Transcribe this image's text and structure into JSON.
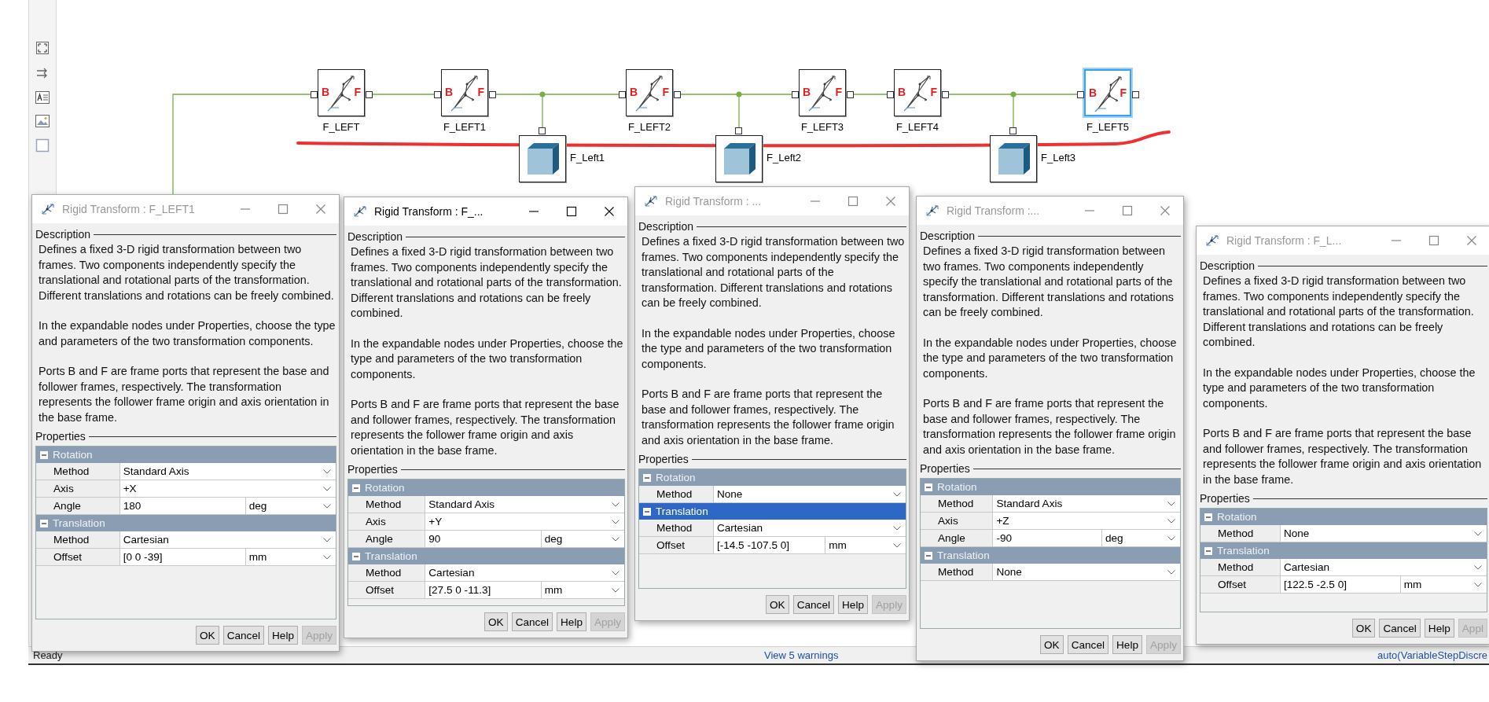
{
  "diagram": {
    "transform_blocks": [
      {
        "name": "F_LEFT",
        "base_port": "B",
        "follower_port": "F",
        "selected": false
      },
      {
        "name": "F_LEFT1",
        "base_port": "B",
        "follower_port": "F",
        "selected": false
      },
      {
        "name": "F_LEFT2",
        "base_port": "B",
        "follower_port": "F",
        "selected": false
      },
      {
        "name": "F_LEFT3",
        "base_port": "B",
        "follower_port": "F",
        "selected": false
      },
      {
        "name": "F_LEFT4",
        "base_port": "B",
        "follower_port": "F",
        "selected": false
      },
      {
        "name": "F_LEFT5",
        "base_port": "B",
        "follower_port": "F",
        "selected": true
      }
    ],
    "solid_blocks": [
      {
        "name": "F_Left1"
      },
      {
        "name": "F_Left2"
      },
      {
        "name": "F_Left3"
      }
    ]
  },
  "dialogs": [
    {
      "title": "Rigid Transform : F_LEFT1",
      "active": false,
      "description_heading": "Description",
      "paragraphs": [
        "Defines a fixed 3-D rigid transformation between two frames. Two components independently specify the translational and rotational parts of the transformation. Different translations and rotations can be freely combined.",
        "In the expandable nodes under Properties, choose the type and parameters of the two transformation components.",
        "Ports B and F are frame ports that represent the base and follower frames, respectively. The transformation represents the follower frame origin and axis orientation in the base frame."
      ],
      "properties_heading": "Properties",
      "sections": [
        {
          "label": "Rotation",
          "expanded": true,
          "selected": false,
          "rows": [
            {
              "label": "Method",
              "value": "Standard Axis"
            },
            {
              "label": "Axis",
              "value": "+X"
            },
            {
              "label": "Angle",
              "value": "180",
              "unit": "deg"
            }
          ]
        },
        {
          "label": "Translation",
          "expanded": true,
          "selected": false,
          "rows": [
            {
              "label": "Method",
              "value": "Cartesian"
            },
            {
              "label": "Offset",
              "value": "[0 0 -39]",
              "unit": "mm"
            }
          ]
        }
      ],
      "buttons": [
        {
          "label": "OK",
          "disabled": false
        },
        {
          "label": "Cancel",
          "disabled": false
        },
        {
          "label": "Help",
          "disabled": false
        },
        {
          "label": "Apply",
          "disabled": true
        }
      ]
    },
    {
      "title": "Rigid Transform : F_...",
      "active": true,
      "description_heading": "Description",
      "paragraphs": [
        "Defines a fixed 3-D rigid transformation between two frames. Two components independently specify the translational and rotational parts of the transformation. Different translations and rotations can be freely combined.",
        "In the expandable nodes under Properties, choose the type and parameters of the two transformation components.",
        "Ports B and F are frame ports that represent the base and follower frames, respectively. The transformation represents the follower frame origin and axis orientation in the base frame."
      ],
      "properties_heading": "Properties",
      "sections": [
        {
          "label": "Rotation",
          "expanded": true,
          "selected": false,
          "rows": [
            {
              "label": "Method",
              "value": "Standard Axis"
            },
            {
              "label": "Axis",
              "value": "+Y"
            },
            {
              "label": "Angle",
              "value": "90",
              "unit": "deg"
            }
          ]
        },
        {
          "label": "Translation",
          "expanded": true,
          "selected": false,
          "rows": [
            {
              "label": "Method",
              "value": "Cartesian"
            },
            {
              "label": "Offset",
              "value": "[27.5 0 -11.3]",
              "unit": "mm"
            }
          ]
        }
      ],
      "buttons": [
        {
          "label": "OK",
          "disabled": false
        },
        {
          "label": "Cancel",
          "disabled": false
        },
        {
          "label": "Help",
          "disabled": false
        },
        {
          "label": "Apply",
          "disabled": true
        }
      ]
    },
    {
      "title": "Rigid Transform : ...",
      "active": false,
      "description_heading": "Description",
      "paragraphs": [
        "Defines a fixed 3-D rigid transformation between two frames. Two components independently specify the translational and rotational parts of the transformation. Different translations and rotations can be freely combined.",
        "In the expandable nodes under Properties, choose the type and parameters of the two transformation components.",
        "Ports B and F are frame ports that represent the base and follower frames, respectively. The transformation represents the follower frame origin and axis orientation in the base frame."
      ],
      "properties_heading": "Properties",
      "sections": [
        {
          "label": "Rotation",
          "expanded": true,
          "selected": false,
          "rows": [
            {
              "label": "Method",
              "value": "None"
            }
          ]
        },
        {
          "label": "Translation",
          "expanded": true,
          "selected": true,
          "rows": [
            {
              "label": "Method",
              "value": "Cartesian"
            },
            {
              "label": "Offset",
              "value": "[-14.5 -107.5 0]",
              "unit": "mm"
            }
          ]
        }
      ],
      "buttons": [
        {
          "label": "OK",
          "disabled": false
        },
        {
          "label": "Cancel",
          "disabled": false
        },
        {
          "label": "Help",
          "disabled": false
        },
        {
          "label": "Apply",
          "disabled": true
        }
      ]
    },
    {
      "title": "Rigid Transform :...",
      "active": false,
      "description_heading": "Description",
      "paragraphs": [
        "Defines a fixed 3-D rigid transformation between two frames. Two components independently specify the translational and rotational parts of the transformation. Different translations and rotations can be freely combined.",
        "In the expandable nodes under Properties, choose the type and parameters of the two transformation components.",
        "Ports B and F are frame ports that represent the base and follower frames, respectively. The transformation represents the follower frame origin and axis orientation in the base frame."
      ],
      "properties_heading": "Properties",
      "sections": [
        {
          "label": "Rotation",
          "expanded": true,
          "selected": false,
          "rows": [
            {
              "label": "Method",
              "value": "Standard Axis"
            },
            {
              "label": "Axis",
              "value": "+Z"
            },
            {
              "label": "Angle",
              "value": "-90",
              "unit": "deg"
            }
          ]
        },
        {
          "label": "Translation",
          "expanded": true,
          "selected": false,
          "rows": [
            {
              "label": "Method",
              "value": "None"
            }
          ]
        }
      ],
      "buttons": [
        {
          "label": "OK",
          "disabled": false
        },
        {
          "label": "Cancel",
          "disabled": false
        },
        {
          "label": "Help",
          "disabled": false
        },
        {
          "label": "Apply",
          "disabled": true
        }
      ]
    },
    {
      "title": "Rigid Transform : F_L...",
      "active": false,
      "description_heading": "Description",
      "paragraphs": [
        "Defines a fixed 3-D rigid transformation between two frames. Two components independently specify the translational and rotational parts of the transformation. Different translations and rotations can be freely combined.",
        "In the expandable nodes under Properties, choose the type and parameters of the two transformation components.",
        "Ports B and F are frame ports that represent the base and follower frames, respectively. The transformation represents the follower frame origin and axis orientation in the base frame."
      ],
      "properties_heading": "Properties",
      "sections": [
        {
          "label": "Rotation",
          "expanded": true,
          "selected": false,
          "rows": [
            {
              "label": "Method",
              "value": "None"
            }
          ]
        },
        {
          "label": "Translation",
          "expanded": true,
          "selected": false,
          "rows": [
            {
              "label": "Method",
              "value": "Cartesian"
            },
            {
              "label": "Offset",
              "value": "[122.5 -2.5 0]",
              "unit": "mm"
            }
          ]
        }
      ],
      "buttons": [
        {
          "label": "OK",
          "disabled": false
        },
        {
          "label": "Cancel",
          "disabled": false
        },
        {
          "label": "Help",
          "disabled": false
        },
        {
          "label": "Appl",
          "disabled": true
        }
      ]
    }
  ],
  "status_bar": {
    "status": "Ready",
    "warnings_link": "View 5 warnings",
    "solver": "auto(VariableStepDiscre"
  }
}
